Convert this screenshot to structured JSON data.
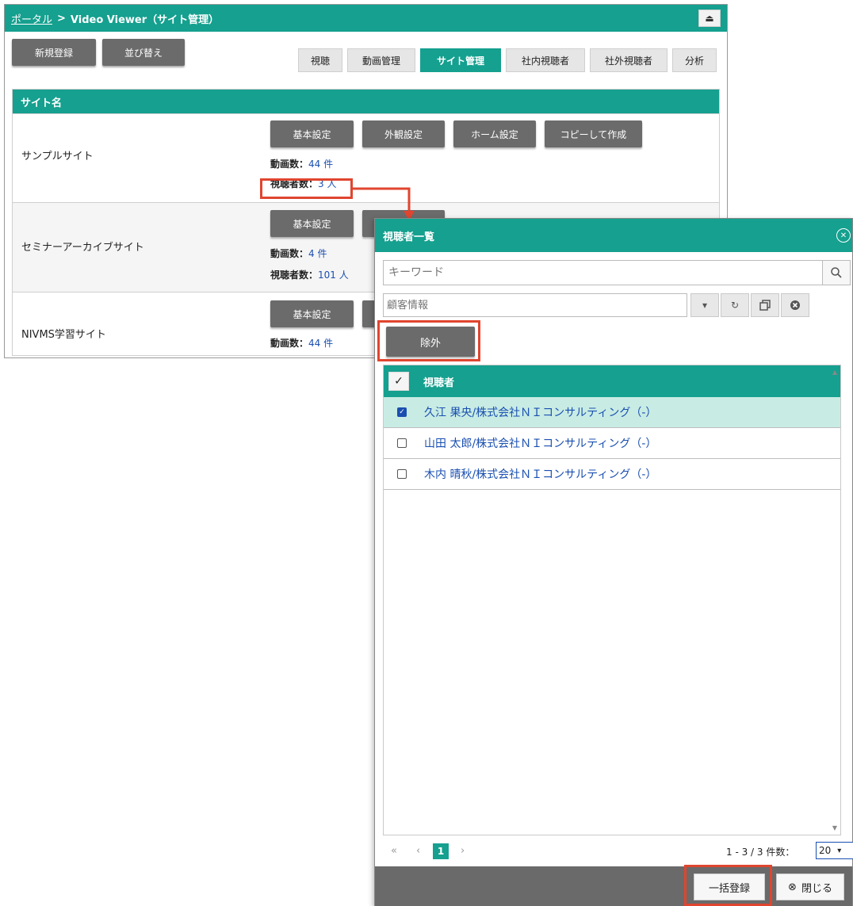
{
  "breadcrumb": {
    "portal": "ポータル",
    "separator": ">",
    "current": "Video Viewer（サイト管理）"
  },
  "header": {
    "collapse_icon": "⏏"
  },
  "toolbar": {
    "new_label": "新規登録",
    "sort_label": "並び替え"
  },
  "tabs": [
    {
      "label": "視聴",
      "active": false
    },
    {
      "label": "動画管理",
      "active": false
    },
    {
      "label": "サイト管理",
      "active": true
    },
    {
      "label": "社内視聴者",
      "active": false
    },
    {
      "label": "社外視聴者",
      "active": false
    },
    {
      "label": "分析",
      "active": false
    }
  ],
  "site_table": {
    "header": "サイト名",
    "buttons": {
      "basic": "基本設定",
      "appearance": "外観設定",
      "home": "ホーム設定",
      "copy": "コピーして作成"
    },
    "video_count_label": "動画数：",
    "viewer_count_label": "視聴者数：",
    "rows": [
      {
        "name": "サンプルサイト",
        "videos": "44 件",
        "viewers": "3 人"
      },
      {
        "name": "セミナーアーカイブサイト",
        "videos": "4 件",
        "viewers": "101 人"
      },
      {
        "name": "NIVMS学習サイト",
        "videos": "44 件"
      }
    ]
  },
  "modal": {
    "title": "視聴者一覧",
    "keyword_placeholder": "キーワード",
    "customer_placeholder": "顧客情報",
    "exclude_label": "除外",
    "column_header": "視聴者",
    "check_all_glyph": "✓",
    "viewers": [
      {
        "name": "久江 果央/株式会社ＮＩコンサルティング（-）",
        "checked": true
      },
      {
        "name": "山田 太郎/株式会社ＮＩコンサルティング（-）",
        "checked": false
      },
      {
        "name": "木内 晴秋/株式会社ＮＩコンサルティング（-）",
        "checked": false
      }
    ],
    "pager": {
      "first": "«",
      "prev": "‹",
      "current": "1",
      "next": "›",
      "count": "1 - 3 / 3 件数：",
      "page_size": "20"
    },
    "bulk_label": "一括登録",
    "close_label": "閉じる"
  },
  "colors": {
    "teal": "#15a08f",
    "dark_button": "#6b6b6b",
    "annotation_red": "#e0452f",
    "link": "#1a4fb0"
  }
}
